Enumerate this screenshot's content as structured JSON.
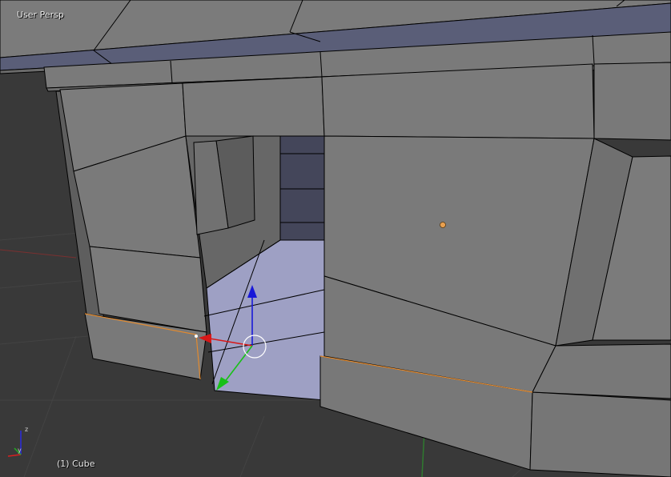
{
  "viewport": {
    "view_label": "User Persp",
    "object_label": "(1) Cube",
    "background_color": "#393939",
    "mesh_face_color": "#787878",
    "selected_face_color": "#9ea0c4",
    "selection_edge_color": "#e28a2f",
    "manipulator": {
      "x_color": "#d81818",
      "y_color": "#18c018",
      "z_color": "#1818d8"
    }
  },
  "axis_gizmo": {
    "z_label": "z",
    "y_label": "y"
  }
}
